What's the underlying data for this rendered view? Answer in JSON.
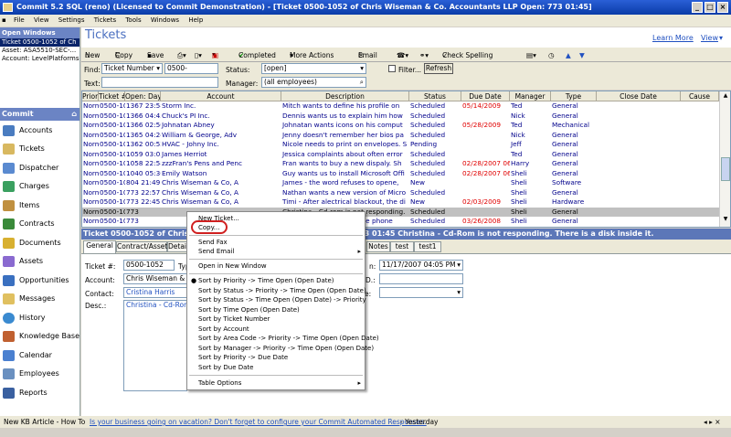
{
  "window": {
    "title": "Commit  5.2 SQL  (reno)  (Licensed to Commit Demonstration) - [Ticket  0500-1052 of Chris Wiseman & Co. Accountants LLP Open:   773 01:45]"
  },
  "menu": [
    "File",
    "View",
    "Settings",
    "Tickets",
    "Tools",
    "Windows",
    "Help"
  ],
  "open_windows": {
    "header": "Open Windows",
    "selected": "Ticket  0500-1052 of Ch",
    "lines": [
      "Asset: ASA5510-SEC-...",
      "Account:  LevelPlatforms"
    ]
  },
  "commit_nav": {
    "header": "Commit",
    "items": [
      "Accounts",
      "Tickets",
      "Dispatcher",
      "Charges",
      "Items",
      "Contracts",
      "Documents",
      "Assets",
      "Opportunities",
      "Messages",
      "History",
      "Knowledge Base",
      "Calendar",
      "Employees",
      "Reports"
    ]
  },
  "main": {
    "title": "Tickets",
    "learn_more": "Learn More",
    "view": "View"
  },
  "toolbar": {
    "new": "New",
    "copy": "Copy",
    "save": "Save",
    "completed": "Completed",
    "more_actions": "More Actions",
    "email": "Email",
    "check_spelling": "Check Spelling"
  },
  "filter": {
    "find_label": "Find:",
    "find_field": "Ticket Number",
    "find_value": "0500-",
    "status_label": "Status:",
    "status_value": "[open]",
    "filter_label": "Filter...",
    "refresh": "Refresh",
    "text_label": "Text:",
    "manager_label": "Manager:",
    "manager_value": "(all employees)"
  },
  "grid": {
    "columns": [
      "Priority",
      "Ticket #",
      "Open: Days/Hrs",
      "Account",
      "Description",
      "Status",
      "Due Date",
      "Manager",
      "Type",
      "Close Date",
      "Cause"
    ],
    "rows": [
      [
        "Normal",
        "0500-1023",
        "1367 23:58",
        "Storm Inc.",
        "Mitch wants to define his profile on",
        "Scheduled",
        "05/14/2009",
        "Ted",
        "General",
        "",
        ""
      ],
      [
        "Normal",
        "0500-1026",
        "1366 04:45",
        "Chuck's PI Inc.",
        "Dennis wants us to explain him how",
        "Scheduled",
        "",
        "Nick",
        "General",
        "",
        ""
      ],
      [
        "Normal",
        "0500-1027",
        "1366 02:50",
        "Johnatan Abney",
        "Johnatan wants icons on his comput",
        "Scheduled",
        "05/28/2009",
        "Ted",
        "Mechanical",
        "",
        ""
      ],
      [
        "Normal",
        "0500-1028",
        "1365 04:24",
        "William & George, Adv",
        "Jenny doesn't remember her bios pa",
        "Scheduled",
        "",
        "Nick",
        "General",
        "",
        ""
      ],
      [
        "Normal",
        "0500-1029",
        "1362 00:52",
        "HVAC - Johny Inc.",
        "Nicole needs to print on envelopes. S",
        "Pending",
        "",
        "Jeff",
        "General",
        "",
        ""
      ],
      [
        "Normal",
        "0500-1021",
        "1059 03:05",
        "James Herriot",
        "Jessica complaints about often error",
        "Scheduled",
        "",
        "Ted",
        "General",
        "",
        ""
      ],
      [
        "Normal",
        "0500-1024",
        "1058 22:58",
        "zzzFran's Pens and Penc",
        "Fran wants to buy a new dispaly. Sh",
        "Scheduled",
        "02/28/2007 06:00 P",
        "Harry",
        "General",
        "",
        ""
      ],
      [
        "Normal",
        "0500-1025",
        "1040 05:36",
        "Emily Watson",
        "Guy wants us to install Microsoft Offi",
        "Scheduled",
        "02/28/2007 06:00 P",
        "Sheli",
        "General",
        "",
        ""
      ],
      [
        "Normal",
        "0500-1051",
        "804 21:49",
        "Chris Wiseman & Co, A",
        "James - the word refuses to opene,",
        "New",
        "",
        "Sheli",
        "Software",
        "",
        ""
      ],
      [
        "Normal",
        "0500-1049",
        "773 22:57",
        "Chris Wiseman & Co, A",
        "Nathan wants a new version of Micro",
        "Scheduled",
        "",
        "Sheli",
        "General",
        "",
        ""
      ],
      [
        "Normal",
        "0500-1050",
        "773 22:45",
        "Chris Wiseman & Co, A",
        "Timi - After alectrical blackout, the di",
        "New",
        "02/03/2009",
        "Sheli",
        "Hardware",
        "",
        ""
      ],
      [
        "Normal",
        "0500-1052",
        "773",
        "",
        "Christina - Cd-rom is not responding.",
        "Scheduled",
        "",
        "Sheli",
        "General",
        "",
        ""
      ],
      [
        "Normal",
        "0500-1063",
        "773",
        "",
        "Elissa - Cannot handle the phone",
        "Scheduled",
        "03/26/2008",
        "Sheli",
        "General",
        "",
        ""
      ]
    ]
  },
  "detail": {
    "title": "Ticket  0500-1052 of Chris Wiseman & Co. Accountants LLP Open: 773 01:45  Christina - Cd-Rom is not responding. There is a disk inside it.",
    "tabs": [
      "General",
      "Contract/Asset",
      "Detail",
      "Notes",
      "test",
      "test1"
    ],
    "ticket_label": "Ticket #:",
    "ticket_value": "0500-1052",
    "type_label": "Typ",
    "account_label": "Account:",
    "account_value": "Chris Wiseman & Co.",
    "contact_label": "Contact:",
    "contact_value": "Cristina Harris",
    "desc_label": "Desc.:",
    "desc_value": "Christina - Cd-Rom",
    "open_label": "n:",
    "open_value": "11/17/2007 04:05 PM",
    "d_label": "D.:",
    "type2_label": "e:"
  },
  "context_menu": {
    "items": [
      "New Ticket...",
      "Copy...",
      "Send Fax",
      "Send Email",
      "Open in New Window",
      "Sort by Priority -> Time Open (Open Date)",
      "Sort by Status -> Priority -> Time Open (Open Date)",
      "Sort by Status -> Time Open (Open Date) -> Priority",
      "Sort by Time Open (Open Date)",
      "Sort by Ticket Number",
      "Sort by Account",
      "Sort by Area Code -> Priority -> Time Open (Open Date)",
      "Sort by Manager -> Priority -> Time Open (Open Date)",
      "Sort by Priority -> Due Date",
      "Sort by Due Date",
      "Table Options"
    ]
  },
  "status": {
    "left": "New KB Article - How To",
    "link": "Is your business going on vacation? Don't forget to configure your Commit Automated Responses.",
    "suffix": "- Yesterday"
  },
  "colors": {
    "accent": "#0a246a",
    "title_blue": "#4a6fc0",
    "overdue": "#e00000",
    "highlight_circle": "#d02020"
  }
}
